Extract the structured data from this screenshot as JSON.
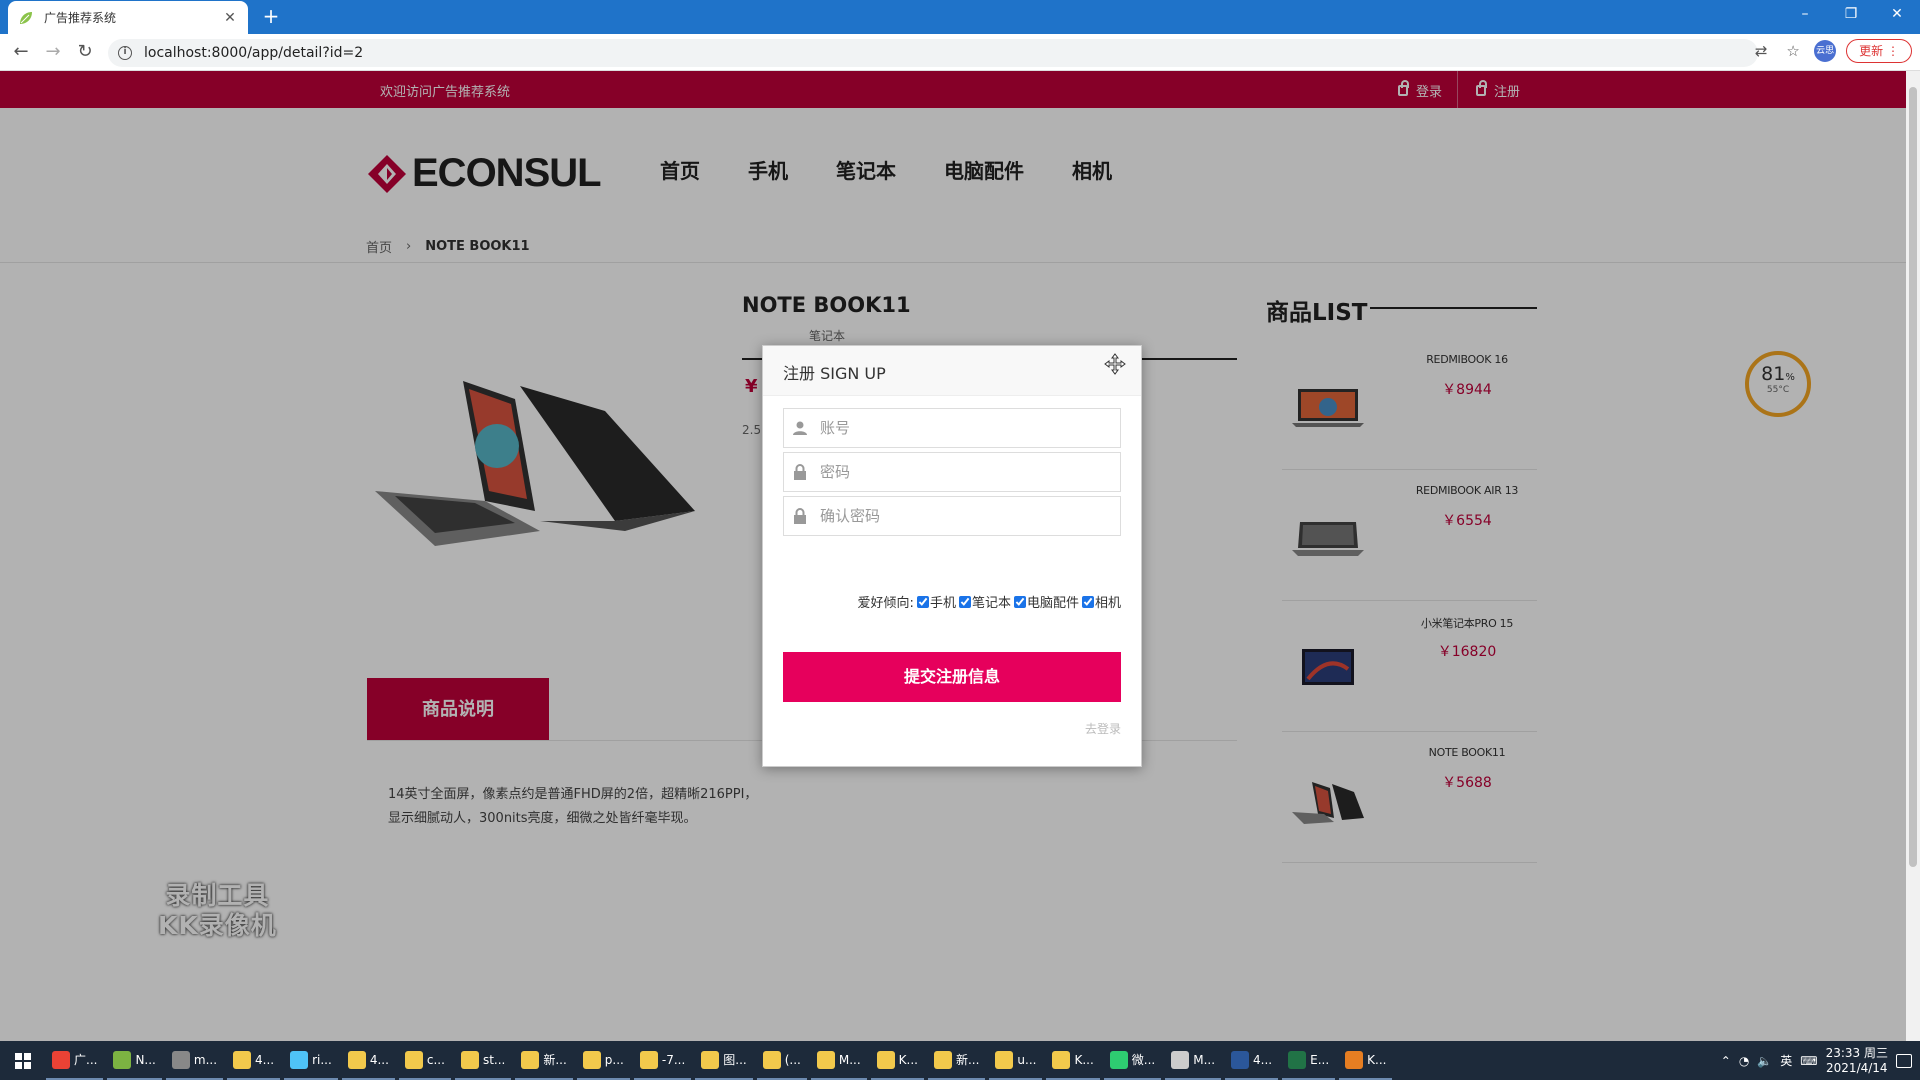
{
  "browser": {
    "tab_title": "广告推荐系统",
    "new_tab": "+",
    "url": "localhost:8000/app/detail?id=2",
    "update_label": "更新",
    "profile_label": "云思",
    "win_min": "–",
    "win_restore": "❐",
    "win_close": "✕"
  },
  "topbar": {
    "welcome": "欢迎访问广告推荐系统",
    "login": "登录",
    "register": "注册"
  },
  "logo_text": "ECONSUL",
  "nav": [
    "首页",
    "手机",
    "笔记本",
    "电脑配件",
    "相机"
  ],
  "breadcrumb": {
    "home": "首页",
    "sep": "›",
    "current": "NOTE BOOK11"
  },
  "product": {
    "title": "NOTE BOOK11",
    "category": "笔记本",
    "price_prefix": "¥",
    "spec": "2.5"
  },
  "description": {
    "tab_label": "商品说明",
    "text": "14英寸全面屏，像素点约是普通FHD屏的2倍，超精晰216PPI，显示细腻动人，300nits亮度，细微之处皆纤毫毕现。"
  },
  "product_list": {
    "title": "商品LIST",
    "items": [
      {
        "name": "REDMIBOOK 16",
        "price": "￥8944"
      },
      {
        "name": "REDMIBOOK AIR 13",
        "price": "￥6554"
      },
      {
        "name": "小米笔记本PRO 15",
        "price": "￥16820"
      },
      {
        "name": "NOTE BOOK11",
        "price": "￥5688"
      }
    ]
  },
  "gauge": {
    "value": "81",
    "unit": "%",
    "temp": "55°C"
  },
  "watermark": {
    "line1": "录制工具",
    "line2": "KK录像机"
  },
  "modal": {
    "title": "注册 SIGN UP",
    "account_placeholder": "账号",
    "password_placeholder": "密码",
    "confirm_placeholder": "确认密码",
    "prefs_label": "爱好倾向:",
    "prefs": [
      {
        "label": "手机",
        "checked": true
      },
      {
        "label": "笔记本",
        "checked": true
      },
      {
        "label": "电脑配件",
        "checked": true
      },
      {
        "label": "相机",
        "checked": true
      }
    ],
    "submit": "提交注册信息",
    "login_link": "去登录"
  },
  "taskbar": {
    "items": [
      "广...",
      "N...",
      "m...",
      "4...",
      "ri...",
      "4...",
      "c...",
      "st...",
      "新...",
      "p...",
      "-7...",
      "图...",
      "(...",
      "M...",
      "K...",
      "新...",
      "u...",
      "K...",
      "微...",
      "M...",
      "4...",
      "E...",
      "K..."
    ],
    "time": "23:33 周三",
    "date": "2021/4/14",
    "ime": "英"
  },
  "colors": {
    "brand": "#c0003a",
    "submit": "#e6005c",
    "tabbar": "#1f73c9"
  }
}
